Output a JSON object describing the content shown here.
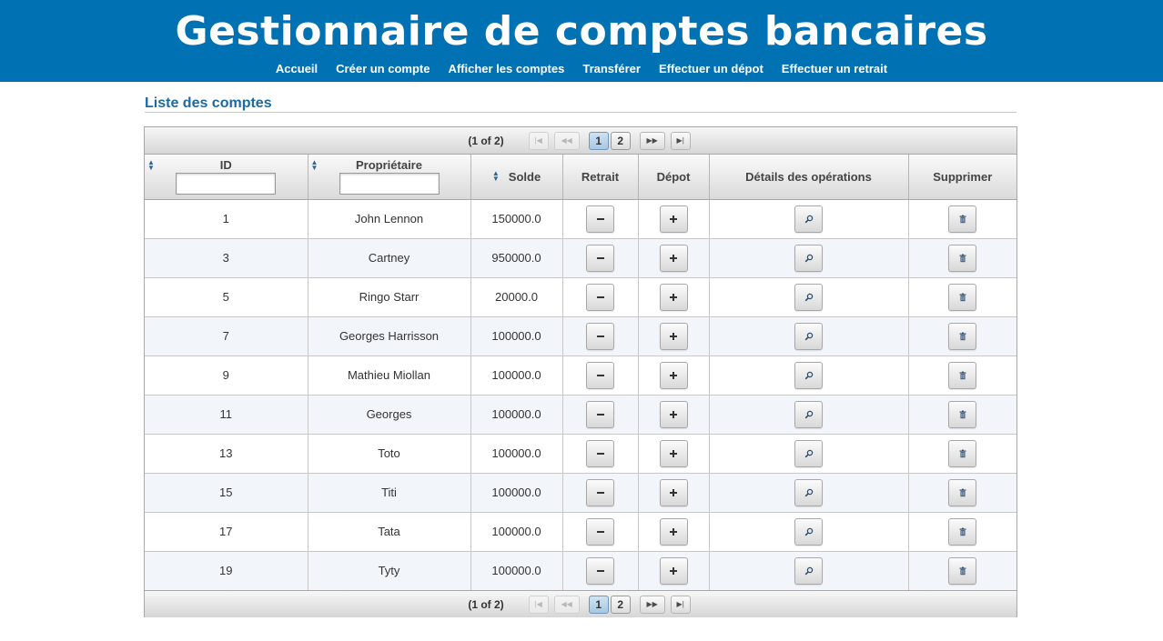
{
  "header": {
    "title": "Gestionnaire de comptes bancaires",
    "menu": [
      "Accueil",
      "Créer un compte",
      "Afficher les comptes",
      "Transférer",
      "Effectuer un dépot",
      "Effectuer un retrait"
    ]
  },
  "section_title": "Liste des comptes",
  "paginator": {
    "report": "(1 of 2)",
    "first_icon": "first-page-icon",
    "prev_icon": "previous-page-icon",
    "pages": [
      "1",
      "2"
    ],
    "current_page": "1",
    "next_icon": "next-page-icon",
    "last_icon": "last-page-icon"
  },
  "table": {
    "columns": {
      "id": "ID",
      "owner": "Propriétaire",
      "balance": "Solde",
      "withdraw": "Retrait",
      "deposit": "Dépot",
      "details": "Détails des opérations",
      "delete": "Supprimer"
    },
    "filters": {
      "id": "",
      "owner": ""
    },
    "action_icons": {
      "withdraw": "minus-icon",
      "deposit": "plus-icon",
      "details": "magnifier-icon",
      "delete": "trash-icon"
    },
    "rows": [
      {
        "id": "1",
        "owner": "John Lennon",
        "balance": "150000.0"
      },
      {
        "id": "3",
        "owner": "Cartney",
        "balance": "950000.0"
      },
      {
        "id": "5",
        "owner": "Ringo Starr",
        "balance": "20000.0"
      },
      {
        "id": "7",
        "owner": "Georges Harrisson",
        "balance": "100000.0"
      },
      {
        "id": "9",
        "owner": "Mathieu Miollan",
        "balance": "100000.0"
      },
      {
        "id": "11",
        "owner": "Georges",
        "balance": "100000.0"
      },
      {
        "id": "13",
        "owner": "Toto",
        "balance": "100000.0"
      },
      {
        "id": "15",
        "owner": "Titi",
        "balance": "100000.0"
      },
      {
        "id": "17",
        "owner": "Tata",
        "balance": "100000.0"
      },
      {
        "id": "19",
        "owner": "Tyty",
        "balance": "100000.0"
      }
    ]
  },
  "colors": {
    "header_bg": "#0071b2",
    "section_title": "#1c6aa3",
    "even_row": "#f2f6fa",
    "active_page": "#a7c7e2"
  }
}
